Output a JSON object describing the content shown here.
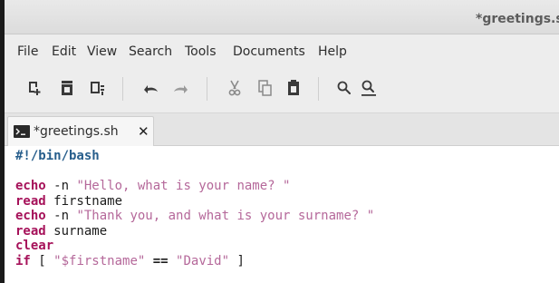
{
  "window": {
    "title": "*greetings.s"
  },
  "menubar": {
    "items": [
      "File",
      "Edit",
      "View",
      "Search",
      "Tools",
      "Documents",
      "Help"
    ]
  },
  "toolbar": {
    "buttons": [
      {
        "icon": "new-document-icon"
      },
      {
        "icon": "open-document-icon"
      },
      {
        "icon": "save-document-icon"
      },
      {
        "icon": "undo-icon"
      },
      {
        "icon": "redo-icon"
      },
      {
        "icon": "cut-icon"
      },
      {
        "icon": "copy-icon"
      },
      {
        "icon": "paste-icon"
      },
      {
        "icon": "find-icon"
      },
      {
        "icon": "find-replace-icon"
      }
    ]
  },
  "tab": {
    "label": "*greetings.sh",
    "close": "✕",
    "icon": "terminal-file-icon"
  },
  "editor": {
    "lines": [
      [
        {
          "t": "#!/bin/bash",
          "c": "shebang"
        }
      ],
      [],
      [
        {
          "t": "echo",
          "c": "kw"
        },
        {
          "t": " -n ",
          "c": "plain"
        },
        {
          "t": "\"Hello, what is your name? \"",
          "c": "str"
        }
      ],
      [
        {
          "t": "read",
          "c": "kw"
        },
        {
          "t": " firstname",
          "c": "plain"
        }
      ],
      [
        {
          "t": "echo",
          "c": "kw"
        },
        {
          "t": " -n ",
          "c": "plain"
        },
        {
          "t": "\"Thank you, and what is your surname? \"",
          "c": "str"
        }
      ],
      [
        {
          "t": "read",
          "c": "kw"
        },
        {
          "t": " surname",
          "c": "plain"
        }
      ],
      [
        {
          "t": "clear",
          "c": "kw"
        }
      ],
      [
        {
          "t": "if",
          "c": "kw"
        },
        {
          "t": " [ ",
          "c": "plain"
        },
        {
          "t": "\"$firstname\"",
          "c": "str"
        },
        {
          "t": " == ",
          "c": "op"
        },
        {
          "t": "\"David\"",
          "c": "str"
        },
        {
          "t": " ]",
          "c": "plain"
        }
      ]
    ]
  },
  "colors": {
    "keyword": "#a6125a",
    "string": "#b5689a",
    "shebang": "#275e8c"
  }
}
